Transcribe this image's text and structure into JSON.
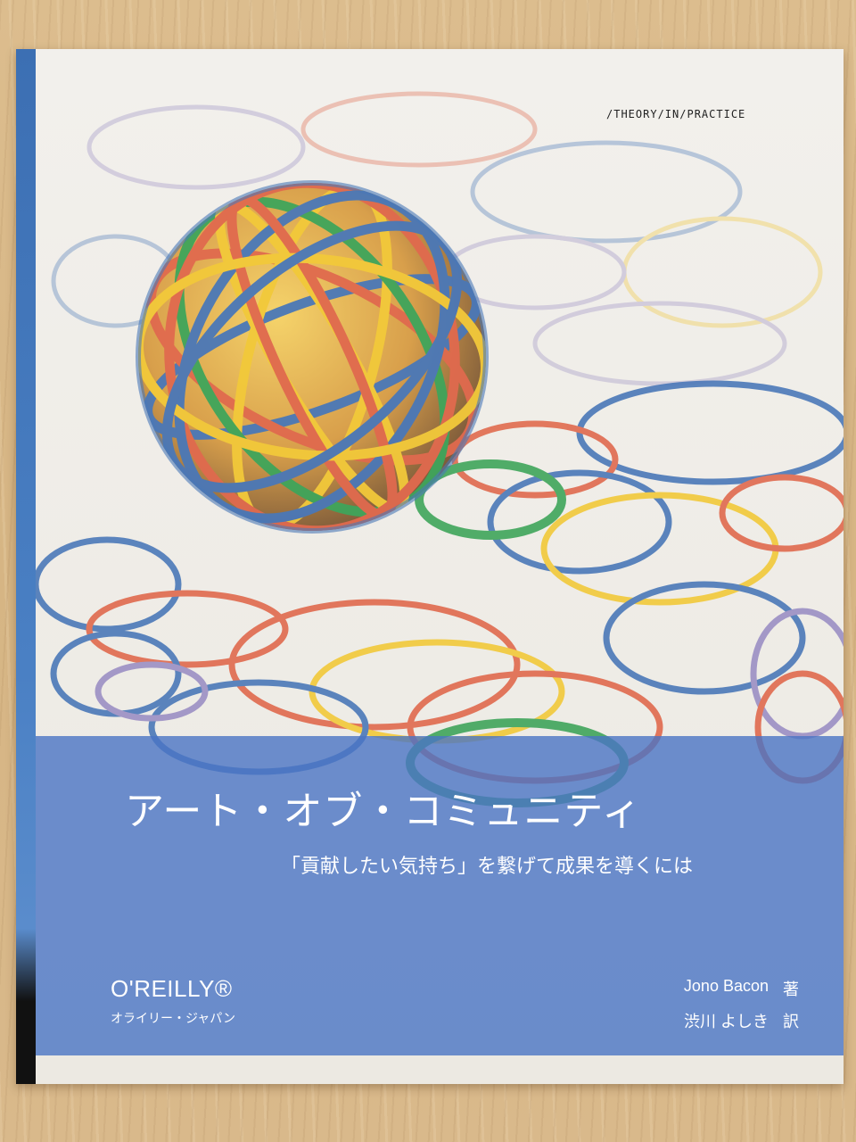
{
  "book": {
    "series": "/THEORY/IN/PRACTICE",
    "title": "アート・オブ・コミュニティ",
    "subtitle": "「貢献したい気持ち」を繋げて成果を導くには",
    "publisher_logo": "O'REILLY®",
    "publisher_name": "オライリー・ジャパン",
    "author": "Jono Bacon",
    "author_role": "著",
    "translator": "渋川 よしき",
    "translator_role": "訳"
  },
  "colors": {
    "panel_blue": "#4a74c4",
    "band_red": "#e06a4e",
    "band_yellow": "#f2c93a",
    "band_blue": "#4a78b8",
    "band_green": "#3fa55b",
    "band_purple": "#9b8fc4"
  }
}
